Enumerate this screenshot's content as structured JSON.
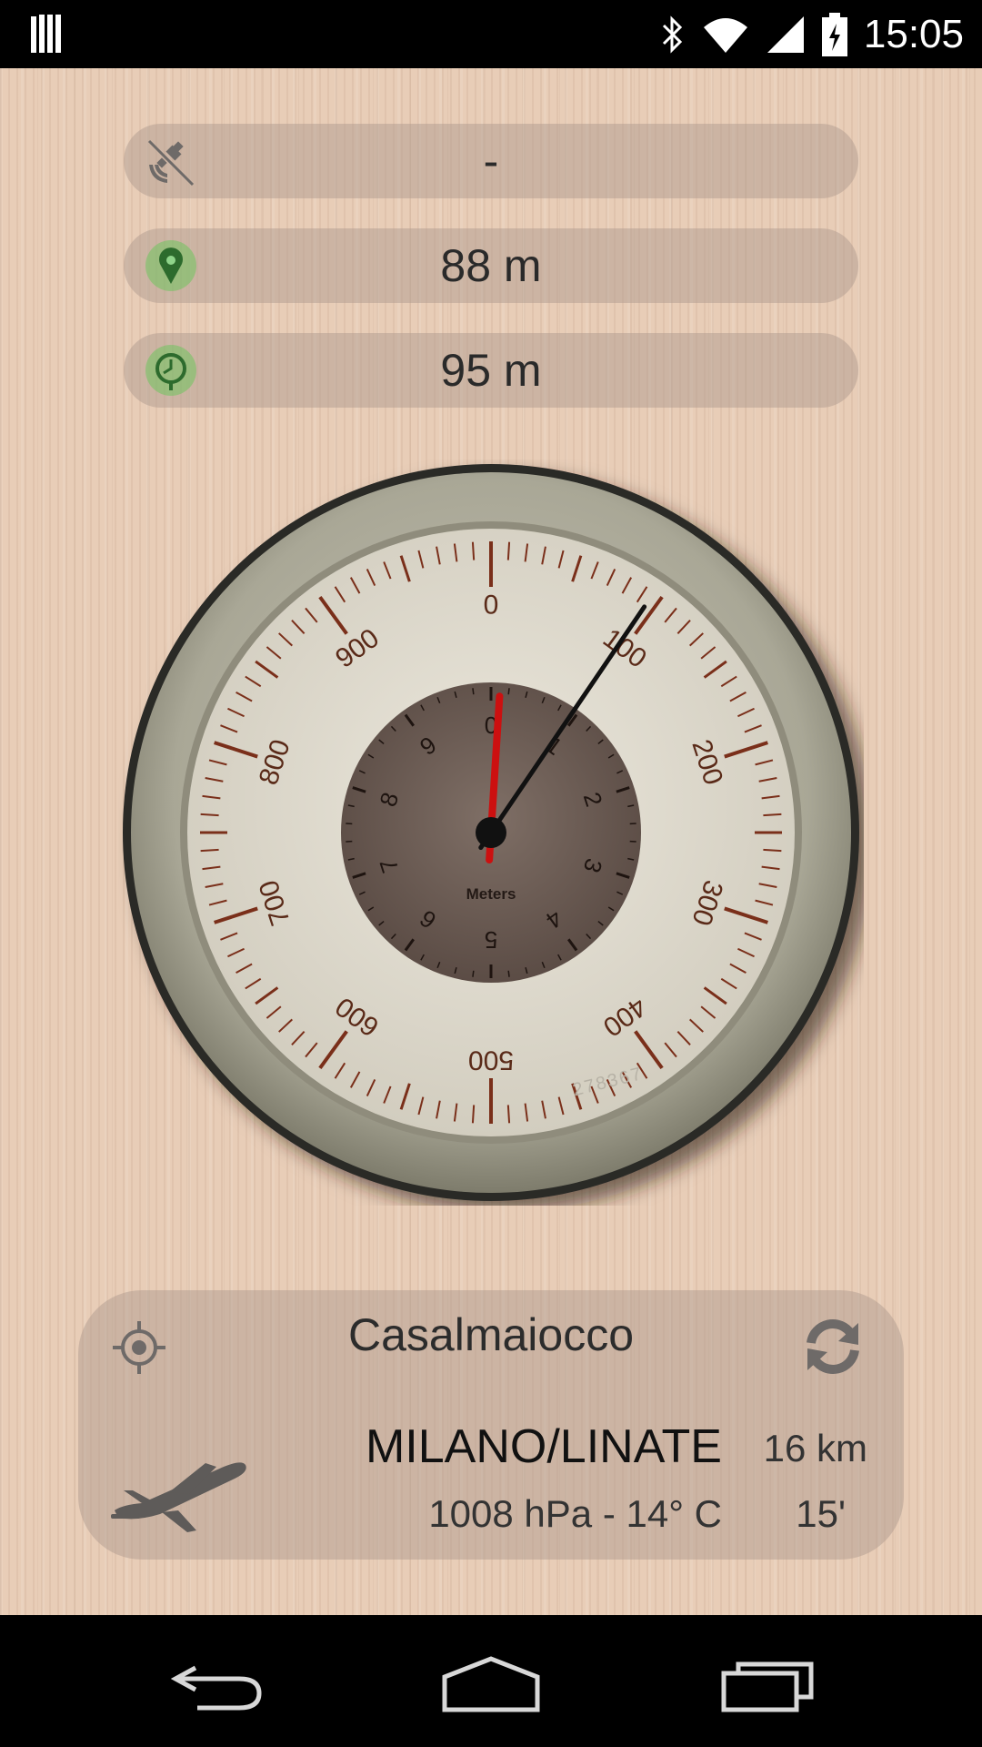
{
  "status_bar": {
    "time": "15:05",
    "icons": [
      "barcode-icon",
      "bluetooth-icon",
      "wifi-icon",
      "signal-icon",
      "battery-charging-icon"
    ]
  },
  "readings": {
    "gps_signal": {
      "icon": "satellite-icon",
      "value": "-"
    },
    "network_altitude": {
      "icon": "location-pin-icon",
      "value": "88 m"
    },
    "barometric_altitude": {
      "icon": "clock-pin-icon",
      "value": "95 m"
    }
  },
  "gauge": {
    "outer_labels": [
      "0",
      "100",
      "200",
      "300",
      "400",
      "500",
      "600",
      "700",
      "800",
      "900"
    ],
    "inner_labels": [
      "0",
      "1",
      "2",
      "3",
      "4",
      "5",
      "6",
      "7",
      "8",
      "9"
    ],
    "unit_label": "Meters",
    "serial": "278367",
    "outer_value": 95,
    "inner_value": 0.1,
    "colors": {
      "tick": "#7a2f1a",
      "needle_long": "#111111",
      "needle_short": "#cc1010"
    }
  },
  "weather_panel": {
    "city": "Casalmaiocco",
    "station": "MILANO/LINATE",
    "distance": "16 km",
    "conditions": "1008 hPa - 14° C",
    "age": "15'"
  },
  "nav_bar": {
    "buttons": [
      "back-icon",
      "home-icon",
      "recents-icon"
    ]
  }
}
